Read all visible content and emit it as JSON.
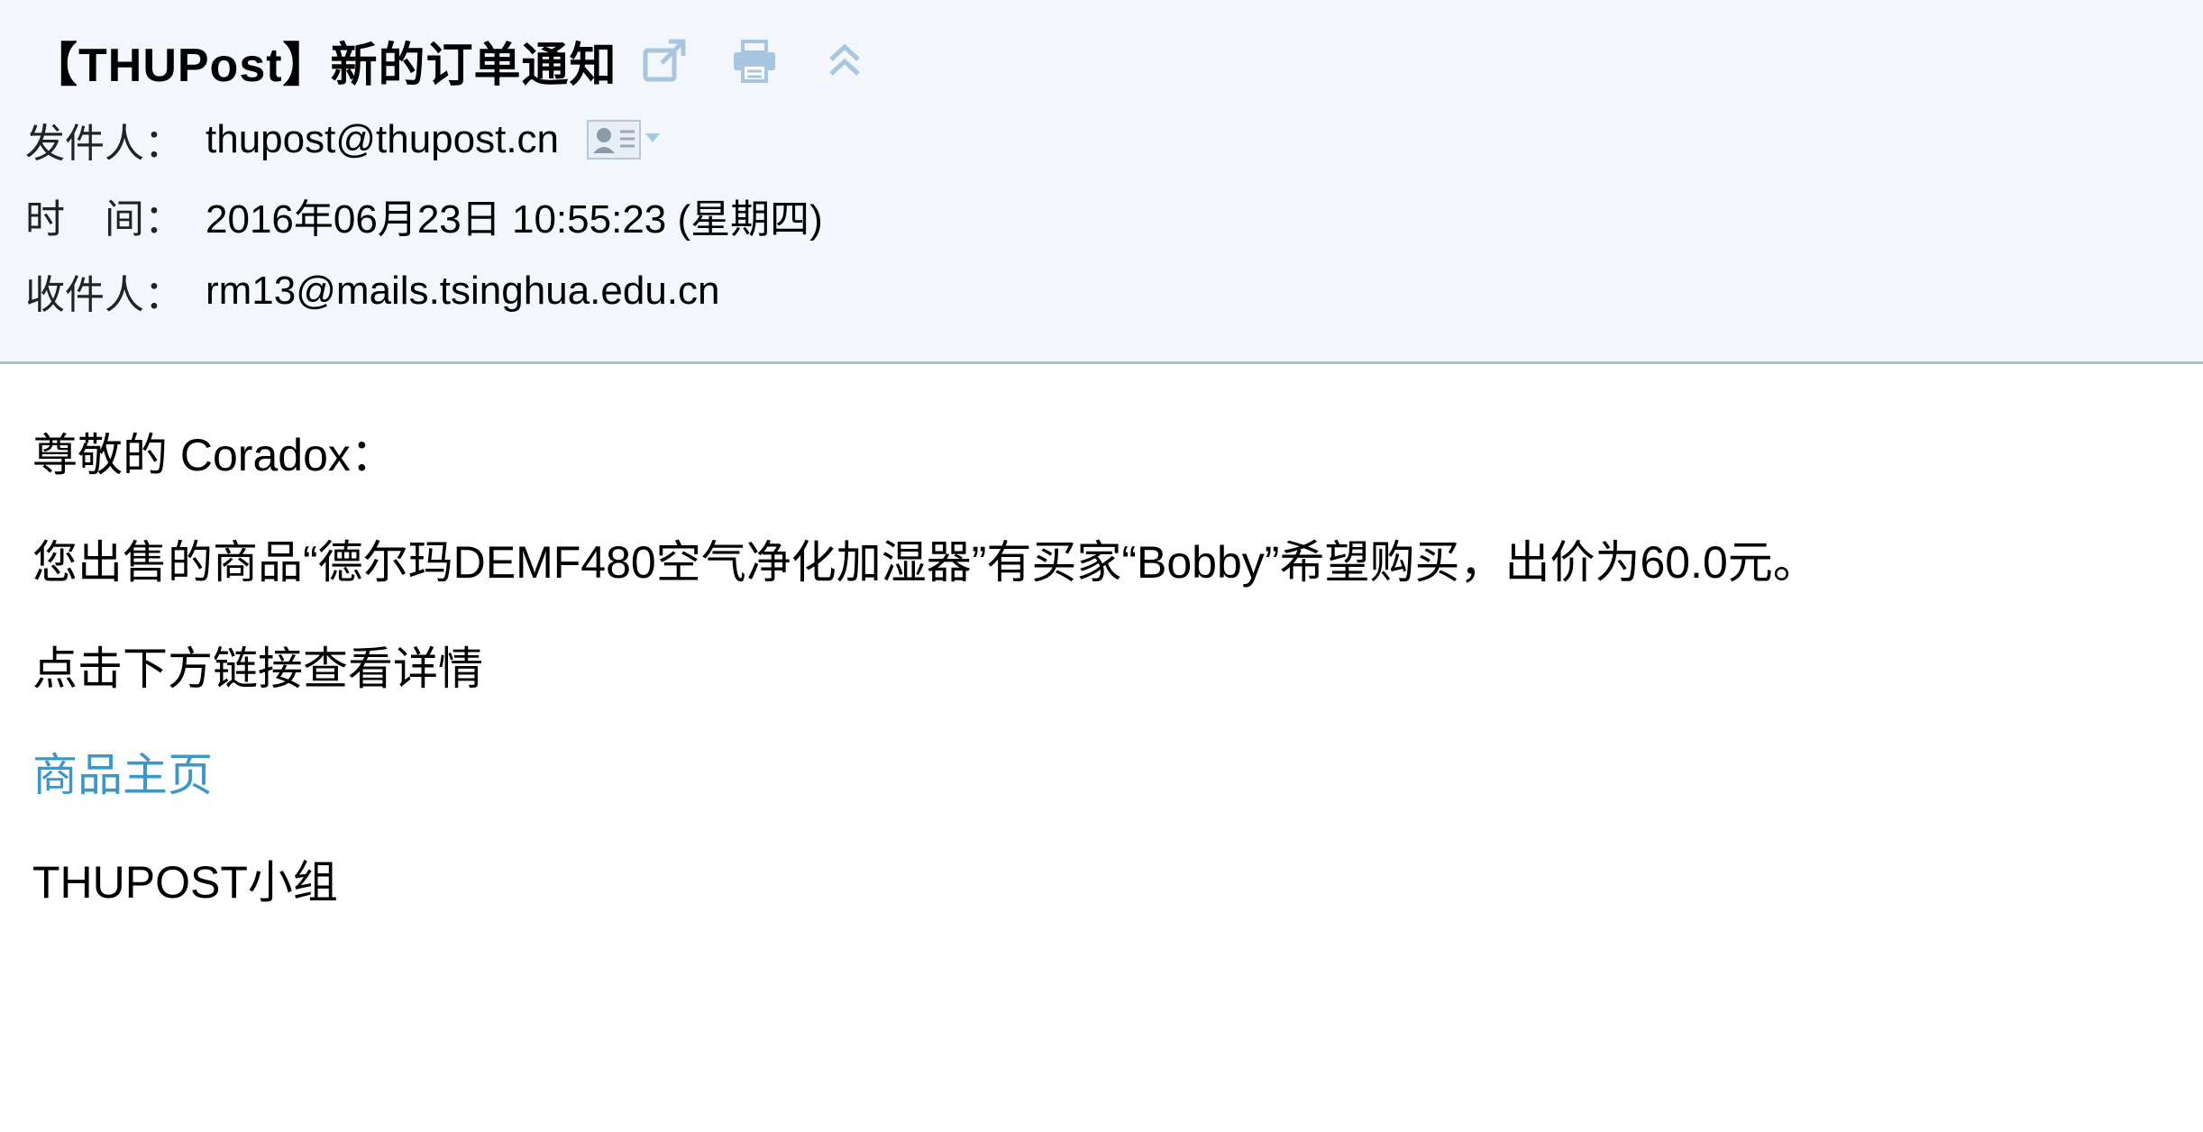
{
  "email": {
    "subject": "【THUPost】新的订单通知",
    "header": {
      "from_label": "发件人：",
      "from_value": "thupost@thupost.cn",
      "time_label": "时　间：",
      "time_value": "2016年06月23日 10:55:23 (星期四)",
      "to_label": "收件人：",
      "to_value": "rm13@mails.tsinghua.edu.cn"
    },
    "toolbar_icons": [
      "popout-icon",
      "print-icon",
      "collapse-icon"
    ],
    "contact_icon": "contact-card-icon",
    "body": {
      "greeting": "尊敬的 Coradox：",
      "message": "您出售的商品“德尔玛DEMF480空气净化加湿器”有买家“Bobby”希望购买，出价为60.0元。",
      "action_text": "点击下方链接查看详情",
      "link_text": "商品主页",
      "signature": "THUPOST小组"
    }
  },
  "colors": {
    "header_background": "#f3f7fb",
    "header_border": "#a8c3d6",
    "link": "#3b97c6",
    "icon": "#a9c6e0"
  }
}
